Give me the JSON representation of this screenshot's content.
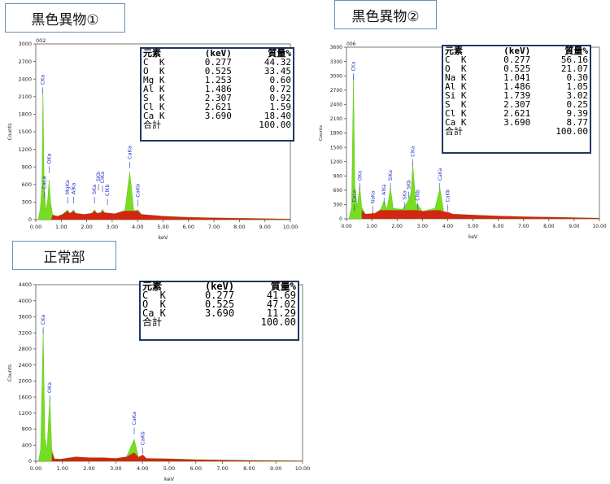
{
  "chart_data": [
    {
      "type": "area",
      "title": "黒色異物①",
      "spectrum_id": "002",
      "xlabel": "keV",
      "ylabel": "Counts",
      "xlim": [
        0,
        10
      ],
      "ylim": [
        0,
        3000
      ],
      "x_ticks": [
        "0.00",
        "1.00",
        "2.00",
        "3.00",
        "4.00",
        "5.00",
        "6.00",
        "7.00",
        "8.00",
        "9.00",
        "10.00"
      ],
      "y_ticks": [
        "0",
        "300",
        "600",
        "900",
        "1200",
        "1500",
        "1800",
        "2100",
        "2400",
        "2700",
        "3000"
      ],
      "spectrum": [
        [
          0.1,
          0
        ],
        [
          0.18,
          200
        ],
        [
          0.24,
          600
        ],
        [
          0.28,
          2250
        ],
        [
          0.33,
          600
        ],
        [
          0.4,
          150
        ],
        [
          0.47,
          350
        ],
        [
          0.525,
          680
        ],
        [
          0.58,
          300
        ],
        [
          0.66,
          80
        ],
        [
          0.85,
          60
        ],
        [
          1.05,
          90
        ],
        [
          1.25,
          170
        ],
        [
          1.33,
          110
        ],
        [
          1.42,
          130
        ],
        [
          1.49,
          170
        ],
        [
          1.56,
          110
        ],
        [
          1.9,
          90
        ],
        [
          2.2,
          110
        ],
        [
          2.31,
          170
        ],
        [
          2.4,
          110
        ],
        [
          2.55,
          120
        ],
        [
          2.62,
          180
        ],
        [
          2.7,
          120
        ],
        [
          3.1,
          100
        ],
        [
          3.5,
          160
        ],
        [
          3.69,
          820
        ],
        [
          3.85,
          150
        ],
        [
          4.01,
          170
        ],
        [
          4.15,
          90
        ],
        [
          5,
          60
        ],
        [
          6,
          40
        ],
        [
          7,
          30
        ],
        [
          8,
          25
        ],
        [
          9,
          18
        ],
        [
          10,
          10
        ]
      ],
      "peak_labels": [
        {
          "text": "CKa",
          "x": 0.277,
          "y": 2300
        },
        {
          "text": "CaLa",
          "x": 0.34,
          "y": 520
        },
        {
          "text": "OKa",
          "x": 0.525,
          "y": 950
        },
        {
          "text": "MgKa",
          "x": 1.253,
          "y": 430
        },
        {
          "text": "AlKa",
          "x": 1.486,
          "y": 430
        },
        {
          "text": "SKa",
          "x": 2.307,
          "y": 430
        },
        {
          "text": "SKb",
          "x": 2.464,
          "y": 650
        },
        {
          "text": "ClKa",
          "x": 2.621,
          "y": 620
        },
        {
          "text": "ClKb",
          "x": 2.815,
          "y": 400
        },
        {
          "text": "CaKa",
          "x": 3.69,
          "y": 1030
        },
        {
          "text": "CaKb",
          "x": 4.01,
          "y": 380
        }
      ],
      "table": {
        "header": [
          "元素",
          "(keV)",
          "質量%"
        ],
        "rows": [
          [
            "C  K",
            "0.277",
            "44.32"
          ],
          [
            "O  K",
            "0.525",
            "33.45"
          ],
          [
            "Mg K",
            "1.253",
            "0.60"
          ],
          [
            "Al K",
            "1.486",
            "0.72"
          ],
          [
            "S  K",
            "2.307",
            "0.92"
          ],
          [
            "Cl K",
            "2.621",
            "1.59"
          ],
          [
            "Ca K",
            "3.690",
            "18.40"
          ],
          [
            "合計",
            "",
            "100.00"
          ]
        ]
      }
    },
    {
      "type": "area",
      "title": "黒色異物②",
      "spectrum_id": "006",
      "xlabel": "keV",
      "ylabel": "Counts",
      "xlim": [
        0,
        10
      ],
      "ylim": [
        0,
        3600
      ],
      "x_ticks": [
        "0.00",
        "1.00",
        "2.00",
        "3.00",
        "4.00",
        "5.00",
        "6.00",
        "7.00",
        "8.00",
        "9.00",
        "10.00"
      ],
      "y_ticks": [
        "0",
        "300",
        "600",
        "900",
        "1200",
        "1500",
        "1800",
        "2100",
        "2400",
        "2700",
        "3000",
        "3300",
        "3600"
      ],
      "spectrum": [
        [
          0.1,
          0
        ],
        [
          0.2,
          250
        ],
        [
          0.277,
          3000
        ],
        [
          0.33,
          700
        ],
        [
          0.42,
          250
        ],
        [
          0.525,
          700
        ],
        [
          0.6,
          250
        ],
        [
          0.75,
          100
        ],
        [
          1.0,
          110
        ],
        [
          1.041,
          130
        ],
        [
          1.1,
          110
        ],
        [
          1.35,
          200
        ],
        [
          1.486,
          380
        ],
        [
          1.6,
          200
        ],
        [
          1.739,
          650
        ],
        [
          1.85,
          220
        ],
        [
          2.2,
          200
        ],
        [
          2.307,
          260
        ],
        [
          2.45,
          400
        ],
        [
          2.55,
          550
        ],
        [
          2.621,
          1150
        ],
        [
          2.75,
          300
        ],
        [
          2.815,
          300
        ],
        [
          3.0,
          160
        ],
        [
          3.5,
          220
        ],
        [
          3.69,
          650
        ],
        [
          3.85,
          150
        ],
        [
          4.01,
          140
        ],
        [
          4.2,
          100
        ],
        [
          5,
          80
        ],
        [
          6,
          60
        ],
        [
          7,
          45
        ],
        [
          8,
          35
        ],
        [
          9,
          25
        ],
        [
          10,
          15
        ]
      ],
      "peak_labels": [
        {
          "text": "CKa",
          "x": 0.277,
          "y": 3100
        },
        {
          "text": "CaLa",
          "x": 0.3,
          "y": 350
        },
        {
          "text": "OKa",
          "x": 0.525,
          "y": 800
        },
        {
          "text": "NaKa",
          "x": 1.041,
          "y": 320
        },
        {
          "text": "AlKa",
          "x": 1.486,
          "y": 500
        },
        {
          "text": "SiKa",
          "x": 1.739,
          "y": 800
        },
        {
          "text": "SKa",
          "x": 2.307,
          "y": 400
        },
        {
          "text": "SKb",
          "x": 2.464,
          "y": 620
        },
        {
          "text": "ClKa",
          "x": 2.621,
          "y": 1300
        },
        {
          "text": "ClKb",
          "x": 2.815,
          "y": 380
        },
        {
          "text": "CaKa",
          "x": 3.69,
          "y": 800
        },
        {
          "text": "CaKb",
          "x": 4.01,
          "y": 350
        }
      ],
      "table": {
        "header": [
          "元素",
          "(keV)",
          "質量%"
        ],
        "rows": [
          [
            "C  K",
            "0.277",
            "56.16"
          ],
          [
            "O  K",
            "0.525",
            "21.07"
          ],
          [
            "Na K",
            "1.041",
            "0.30"
          ],
          [
            "Al K",
            "1.486",
            "1.05"
          ],
          [
            "Si K",
            "1.739",
            "3.02"
          ],
          [
            "S  K",
            "2.307",
            "0.25"
          ],
          [
            "Cl K",
            "2.621",
            "9.39"
          ],
          [
            "Ca K",
            "3.690",
            "8.77"
          ],
          [
            "合計",
            "",
            "100.00"
          ]
        ]
      }
    },
    {
      "type": "area",
      "title": "正常部",
      "spectrum_id": "",
      "xlabel": "keV",
      "ylabel": "Counts",
      "xlim": [
        0,
        10
      ],
      "ylim": [
        0,
        4400
      ],
      "x_ticks": [
        "0.00",
        "1.00",
        "2.00",
        "3.00",
        "4.00",
        "5.00",
        "6.00",
        "7.00",
        "8.00",
        "9.00",
        "10.00"
      ],
      "y_ticks": [
        "0",
        "400",
        "800",
        "1200",
        "1600",
        "2000",
        "2400",
        "2800",
        "3200",
        "3600",
        "4000",
        "4400"
      ],
      "spectrum": [
        [
          0.1,
          0
        ],
        [
          0.18,
          300
        ],
        [
          0.277,
          3300
        ],
        [
          0.34,
          600
        ],
        [
          0.42,
          300
        ],
        [
          0.525,
          1600
        ],
        [
          0.6,
          300
        ],
        [
          0.7,
          60
        ],
        [
          0.9,
          50
        ],
        [
          1.5,
          110
        ],
        [
          2.0,
          90
        ],
        [
          2.5,
          90
        ],
        [
          3.0,
          70
        ],
        [
          3.4,
          110
        ],
        [
          3.69,
          550
        ],
        [
          3.85,
          100
        ],
        [
          4.01,
          160
        ],
        [
          4.15,
          70
        ],
        [
          5,
          60
        ],
        [
          6,
          40
        ],
        [
          7,
          30
        ],
        [
          8,
          20
        ],
        [
          9,
          15
        ],
        [
          10,
          10
        ]
      ],
      "peak_labels": [
        {
          "text": "CKa",
          "x": 0.277,
          "y": 3400
        },
        {
          "text": "OKa",
          "x": 0.525,
          "y": 1700
        },
        {
          "text": "CaKa",
          "x": 3.69,
          "y": 900
        },
        {
          "text": "CaKb",
          "x": 4.01,
          "y": 400
        }
      ],
      "table": {
        "header": [
          "元素",
          "(keV)",
          "質量%"
        ],
        "rows": [
          [
            "C  K",
            "0.277",
            "41.69"
          ],
          [
            "O  K",
            "0.525",
            "47.02"
          ],
          [
            "Ca K",
            "3.690",
            "11.29"
          ],
          [
            "合計",
            "",
            "100.00"
          ]
        ]
      }
    }
  ],
  "colors": {
    "spectrum_fill": "#77dd22",
    "baseline": "#dd1111",
    "axis": "#555555",
    "label": "#2233cc",
    "table_border": "#1f3864",
    "title_border": "#6b8fb5"
  }
}
